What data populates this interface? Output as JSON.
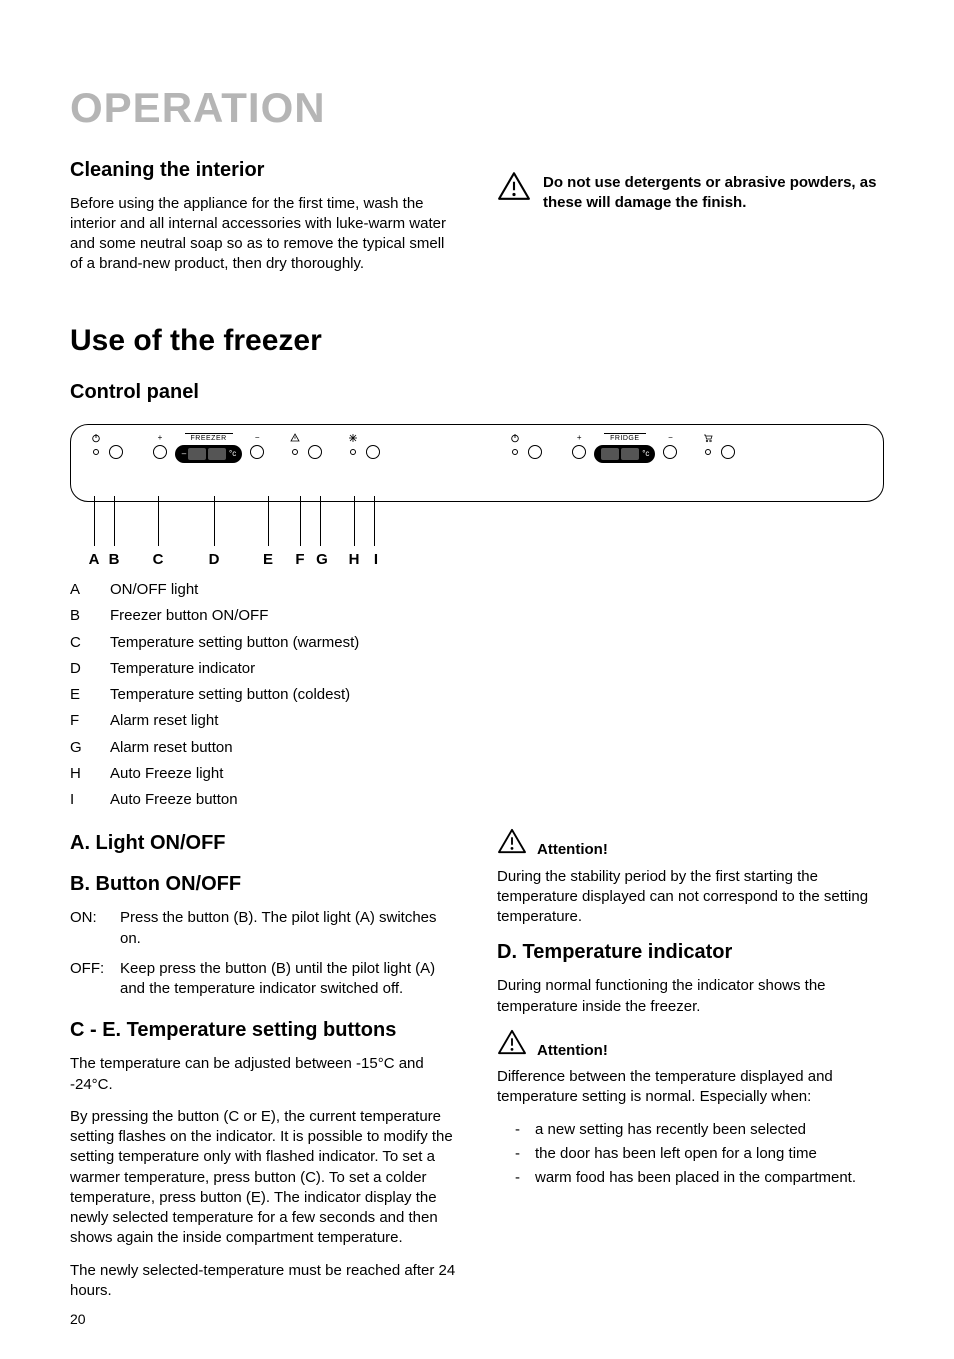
{
  "pageTitle": "OPERATION",
  "pageNumber": "20",
  "cleaning": {
    "heading": "Cleaning the interior",
    "body": "Before using the appliance for the first time, wash the interior and all internal accessories with luke-warm water and some neutral soap so as to remove the typical smell of a brand-new product, then dry thoroughly."
  },
  "topWarning": "Do not use detergents or abrasive powders, as these will damage the finish.",
  "useFreezer": "Use of the freezer",
  "controlPanelHeading": "Control panel",
  "panel": {
    "freezerLabel": "FREEZER",
    "fridgeLabel": "FRIDGE",
    "unit": "°c",
    "plus": "+",
    "minus": "−"
  },
  "callouts": [
    "A",
    "B",
    "C",
    "D",
    "E",
    "F",
    "G",
    "H",
    "I"
  ],
  "legend": [
    {
      "k": "A",
      "v": "ON/OFF light"
    },
    {
      "k": "B",
      "v": "Freezer button ON/OFF"
    },
    {
      "k": "C",
      "v": "Temperature setting button (warmest)"
    },
    {
      "k": "D",
      "v": "Temperature indicator"
    },
    {
      "k": "E",
      "v": "Temperature setting button (coldest)"
    },
    {
      "k": "F",
      "v": "Alarm reset light"
    },
    {
      "k": "G",
      "v": "Alarm reset button"
    },
    {
      "k": "H",
      "v": "Auto Freeze light"
    },
    {
      "k": "I",
      "v": "Auto Freeze button"
    }
  ],
  "secA": "A. Light ON/OFF",
  "secB": "B. Button ON/OFF",
  "onoff": {
    "onLabel": "ON:",
    "onText": "Press the button (B). The pilot light (A) switches on.",
    "offLabel": "OFF:",
    "offText": "Keep press the button (B) until the pilot light (A) and the temperature indicator switched off."
  },
  "secCE": "C - E. Temperature setting buttons",
  "ce": {
    "p1": "The temperature can be adjusted between -15°C and -24°C.",
    "p2": "By pressing the button (C or E), the current temperature setting flashes on the indicator. It is possible to modify the setting temperature only with flashed indicator. To set a warmer temperature, press button (C). To set a colder temperature, press button (E). The indicator display the newly selected temperature for a few seconds and then shows again the inside compartment temperature.",
    "p3": "The newly selected-temperature must be reached after 24 hours."
  },
  "attentionLabel": "Attention!",
  "att1Body": "During the stability period by the first starting the temperature displayed can not correspond to the setting temperature.",
  "secD": "D. Temperature indicator",
  "dBody": "During normal functioning the indicator shows the temperature inside the freezer.",
  "att2Body": "Difference between the temperature displayed and temperature setting is normal. Especially when:",
  "att2List": [
    "a new setting has recently been selected",
    "the door has been left open for a long time",
    "warm food has been placed in the compartment."
  ]
}
